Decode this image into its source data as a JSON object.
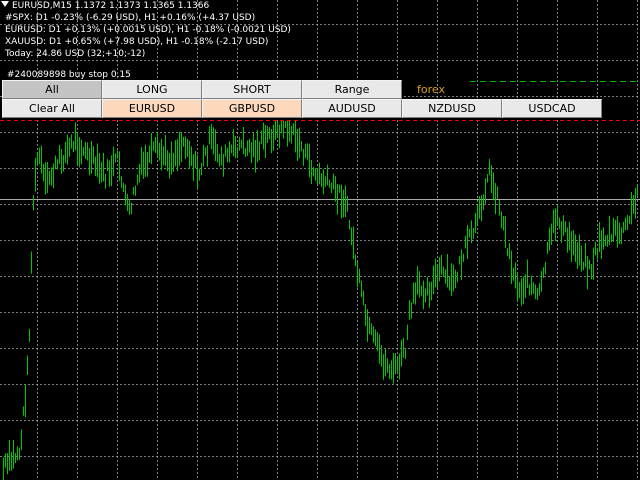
{
  "info": {
    "title": "EURUSD,M15  1.1372 1.1373 1.1365 1.1366",
    "lines": [
      "#SPX: D1 -0.23% (-6.29 USD), H1 +0.16% (+4.37 USD)",
      "EURUSD: D1 +0.13% (+0.0015 USD), H1 -0.18% (-0.0021 USD)",
      "XAUUSD: D1 +0.65% (+7.98 USD), H1 -0.18% (-2.17 USD)",
      "Today: 24.86 USD (32;+10;-12)"
    ],
    "order_label": "#240089898 buy stop 0.15"
  },
  "buttons": {
    "row1": [
      "All",
      "LONG",
      "SHORT",
      "Range"
    ],
    "row2": [
      "Clear All",
      "EURUSD",
      "GBPUSD",
      "AUDUSD",
      "NZDUSD",
      "USDCAD"
    ]
  },
  "forex_label": "forex",
  "colors": {
    "background": "#000000",
    "grid": "#aaaaaa",
    "candles": "#00c800",
    "price_line": "#aaaaaa",
    "order_line": "#ff0000",
    "upper_dashed": "#00b400",
    "selected_button": "#fcd9bd",
    "all_button": "#c4c4c4",
    "button": "#e9e9e9",
    "forex_label": "#d8a020"
  }
}
